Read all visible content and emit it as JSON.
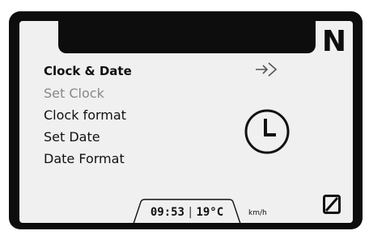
{
  "gear": "N",
  "menu": {
    "title": "Clock & Date",
    "items": [
      {
        "label": "Set Clock",
        "selected": true
      },
      {
        "label": "Clock format",
        "selected": false
      },
      {
        "label": "Set Date",
        "selected": false
      },
      {
        "label": "Date Format",
        "selected": false
      }
    ]
  },
  "icons": {
    "enter": "enter-arrow-icon",
    "clock": "clock-icon",
    "fuel": "fuel-indicator-icon"
  },
  "status": {
    "time": "09:53",
    "temperature": "19°C",
    "speed_unit": "km/h"
  },
  "colors": {
    "frame": "#0d0d0d",
    "screen": "#f0f0f0",
    "selected_text": "#888888"
  }
}
